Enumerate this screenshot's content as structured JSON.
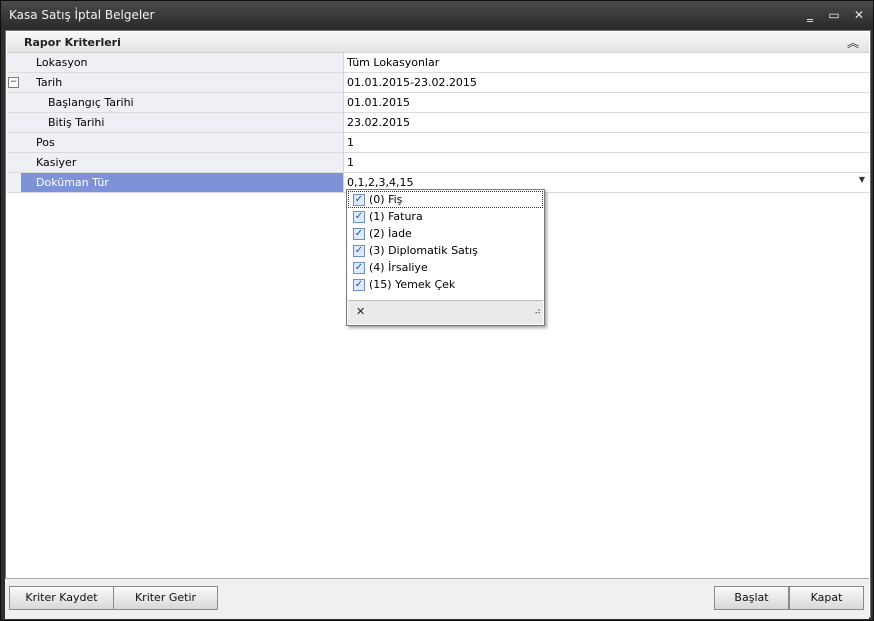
{
  "window": {
    "title": "Kasa Satış İptal Belgeler",
    "minimize": "‗",
    "maximize": "▭",
    "close": "✕"
  },
  "group": {
    "title": "Rapor Kriterleri",
    "collapse_icon": "chevron-double-up-icon",
    "collapse_glyph": "︽"
  },
  "grid": {
    "expander_glyph": "−",
    "dropdown_glyph": "▼",
    "rows": [
      {
        "label": "Lokasyon",
        "value": "Tüm Lokasyonlar"
      },
      {
        "label": "Tarih",
        "value": "01.01.2015-23.02.2015"
      },
      {
        "label": "Başlangıç Tarihi",
        "value": "01.01.2015"
      },
      {
        "label": "Bitiş Tarihi",
        "value": "23.02.2015"
      },
      {
        "label": "Pos",
        "value": "1"
      },
      {
        "label": "Kasiyer",
        "value": "1"
      },
      {
        "label": "Doküman Tür",
        "value": "0,1,2,3,4,15"
      }
    ]
  },
  "dropdown": {
    "check_glyph": "✓",
    "items": [
      {
        "label": "(0) Fiş",
        "checked": true
      },
      {
        "label": "(1) Fatura",
        "checked": true
      },
      {
        "label": "(2) İade",
        "checked": true
      },
      {
        "label": "(3) Diplomatik Satış",
        "checked": true
      },
      {
        "label": "(4) İrsaliye",
        "checked": true
      },
      {
        "label": "(15) Yemek Çek",
        "checked": true
      }
    ],
    "close_glyph": "✕",
    "grip_glyph": "⠴"
  },
  "footer": {
    "save_label": "Kriter Kaydet",
    "load_label": "Kriter Getir",
    "start_label": "Başlat",
    "close_label": "Kapat"
  }
}
